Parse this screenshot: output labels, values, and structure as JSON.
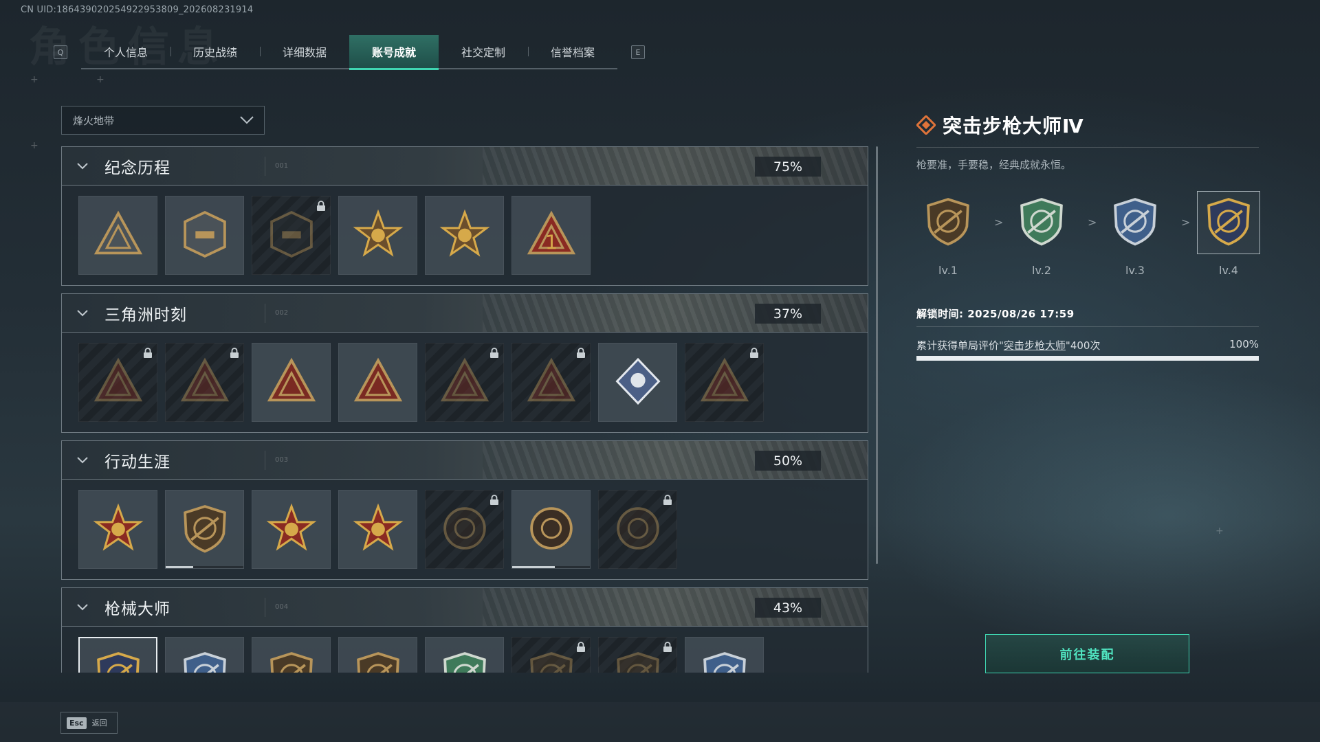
{
  "uid": "CN UID:18643902025492295380​9_202608231914",
  "bg_title": "角色信息",
  "tabs": {
    "left_key": "Q",
    "right_key": "E",
    "items": [
      "个人信息",
      "历史战绩",
      "详细数据",
      "账号成就",
      "社交定制",
      "信誉档案"
    ],
    "active_index": 3
  },
  "filter": {
    "value": "烽火地带"
  },
  "sections": [
    {
      "title": "纪念历程",
      "number": "001",
      "percent": "75%",
      "badges": [
        {
          "icon": "triangle-emblem-icon",
          "locked": false
        },
        {
          "icon": "helicopter-icon",
          "locked": false
        },
        {
          "icon": "hex-shield-icon",
          "locked": true
        },
        {
          "icon": "crossed-rifles-59-icon",
          "locked": false
        },
        {
          "icon": "gear-flower-icon",
          "locked": false
        },
        {
          "icon": "number-one-triangle-icon",
          "locked": false
        }
      ]
    },
    {
      "title": "三角洲时刻",
      "number": "002",
      "percent": "37%",
      "badges": [
        {
          "icon": "delta-lamp-icon",
          "locked": true
        },
        {
          "icon": "delta-squad-icon",
          "locked": true
        },
        {
          "icon": "delta-dice-icon",
          "locked": false
        },
        {
          "icon": "delta-soldiers-icon",
          "locked": false
        },
        {
          "icon": "delta-crowd-icon",
          "locked": true
        },
        {
          "icon": "delta-fish-icon",
          "locked": true
        },
        {
          "icon": "rose-diamond-icon",
          "locked": false
        },
        {
          "icon": "delta-dragon-icon",
          "locked": true
        }
      ]
    },
    {
      "title": "行动生涯",
      "number": "003",
      "percent": "50%",
      "badges": [
        {
          "icon": "star-skull-icon",
          "locked": false
        },
        {
          "icon": "shield-chevron-icon",
          "locked": false,
          "progress": 0.35
        },
        {
          "icon": "stars-shield-icon",
          "locked": false
        },
        {
          "icon": "stars-hex-shield-icon",
          "locked": false
        },
        {
          "icon": "round-helmet-icon",
          "locked": true
        },
        {
          "icon": "round-agent-icon",
          "locked": false,
          "progress": 0.55
        },
        {
          "icon": "round-eye-icon",
          "locked": true
        }
      ]
    },
    {
      "title": "枪械大师",
      "number": "004",
      "percent": "43%",
      "badges": [
        {
          "icon": "rifle-gold-shield-icon",
          "locked": false,
          "selected": true
        },
        {
          "icon": "rifle-blue-shield-icon",
          "locked": false
        },
        {
          "icon": "rifle-bronze-shield-icon",
          "locked": false
        },
        {
          "icon": "rifle-bronze-shield-icon",
          "locked": false
        },
        {
          "icon": "rifle-green-shield-icon",
          "locked": false
        },
        {
          "icon": "rifle-bronze-shield-icon",
          "locked": true
        },
        {
          "icon": "rifle-bronze-shield-icon",
          "locked": true
        },
        {
          "icon": "rifle-blue-shield-icon",
          "locked": false
        }
      ]
    }
  ],
  "detail": {
    "title": "突击步枪大师Ⅳ",
    "description": "枪要准，手要稳，经典成就永恒。",
    "levels": [
      {
        "label": "lv.1",
        "tier": "bronze"
      },
      {
        "label": "lv.2",
        "tier": "green"
      },
      {
        "label": "lv.3",
        "tier": "blue"
      },
      {
        "label": "lv.4",
        "tier": "gold",
        "selected": true
      }
    ],
    "level_arrow": ">",
    "unlock_time": "解锁时间: 2025/08/26 17:59",
    "requirement_prefix": "累计获得单局评价\"",
    "requirement_link": "突击步枪大师",
    "requirement_suffix": "\"400次",
    "requirement_percent": "100%",
    "requirement_progress": 1.0,
    "equip_button": "前往装配"
  },
  "footer": {
    "esc_key": "Esc",
    "back_label": "返回"
  },
  "colors": {
    "accent": "#3fd6b1",
    "bronze": "#b8955a",
    "green": "#3f7a5a",
    "blue": "#3f5f8a",
    "gold": "#d6a94a",
    "red": "#8a2a22"
  }
}
